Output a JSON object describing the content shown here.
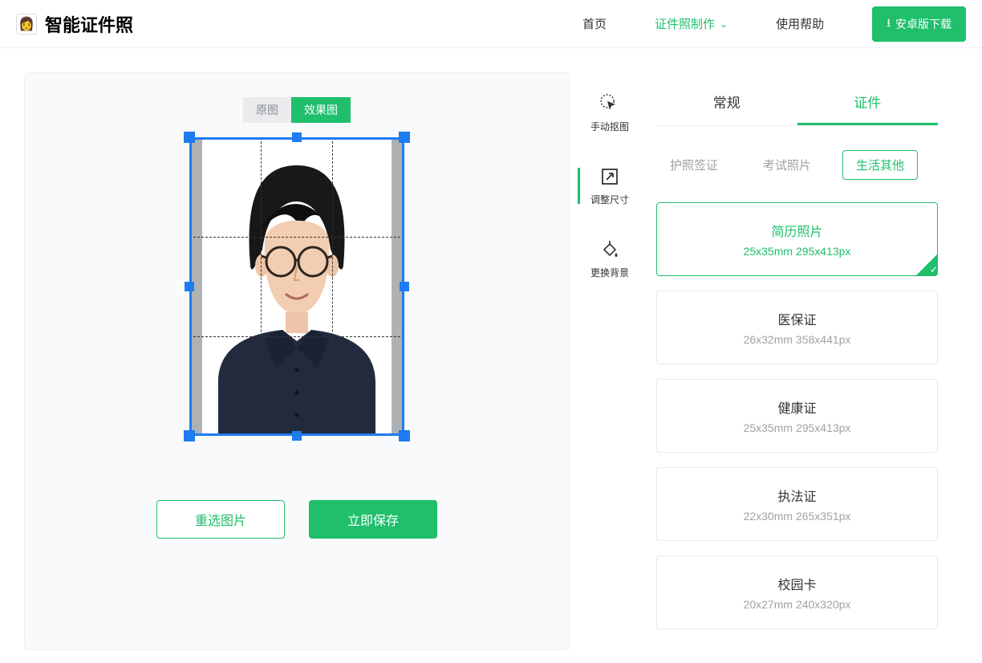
{
  "header": {
    "app_name": "智能证件照",
    "nav": {
      "home": "首页",
      "make": "证件照制作",
      "help": "使用帮助"
    },
    "download_btn": "安卓版下载"
  },
  "editor": {
    "toggle_original": "原图",
    "toggle_preview": "效果图",
    "reselect": "重选图片",
    "save": "立即保存"
  },
  "tools": {
    "manual_cut": "手动抠图",
    "resize": "调整尺寸",
    "change_bg": "更换背景"
  },
  "category_tabs": {
    "normal": "常规",
    "certificate": "证件"
  },
  "sub_tabs": {
    "passport": "护照签证",
    "exam": "考试照片",
    "life": "生活其他"
  },
  "sizes": [
    {
      "name": "简历照片",
      "dim": "25x35mm 295x413px",
      "selected": true
    },
    {
      "name": "医保证",
      "dim": "26x32mm 358x441px",
      "selected": false
    },
    {
      "name": "健康证",
      "dim": "25x35mm 295x413px",
      "selected": false
    },
    {
      "name": "执法证",
      "dim": "22x30mm 265x351px",
      "selected": false
    },
    {
      "name": "校园卡",
      "dim": "20x27mm 240x320px",
      "selected": false
    }
  ]
}
